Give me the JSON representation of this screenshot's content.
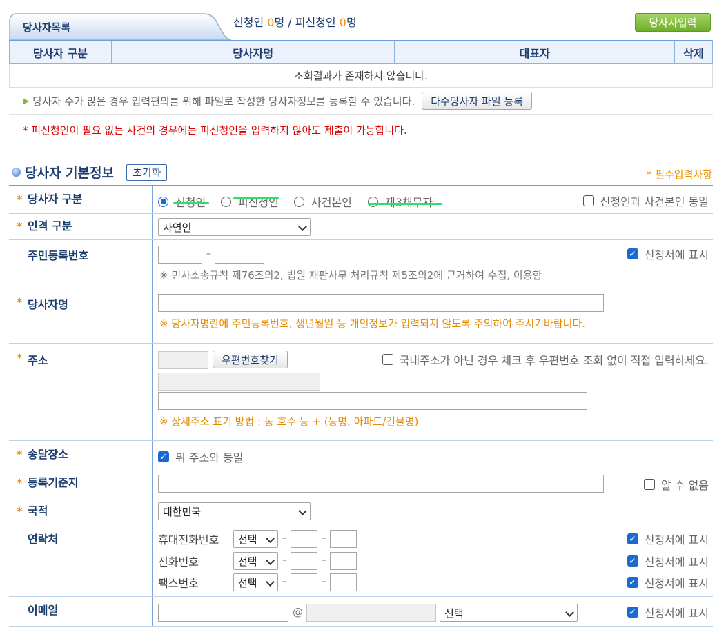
{
  "list": {
    "tab_title": "당사자목록",
    "applicant_label": "신청인",
    "applicant_count": "0",
    "unit1": "명",
    "separator": "/",
    "respondent_label": "피신청인",
    "respondent_count": "0",
    "unit2": "명",
    "add_button": "당사자입력",
    "columns": [
      "당사자 구분",
      "당사자명",
      "대표자",
      "삭제"
    ],
    "empty_message": "조회결과가 존재하지 않습니다.",
    "bulk_info": "당사자 수가 많은 경우 입력편의를 위해 파일로 작성한 당사자정보를 등록할 수 있습니다.",
    "bulk_button": "다수당사자 파일 등록",
    "red_note": "* 피신청인이 필요 없는 사건의 경우에는 피신청인을 입력하지 않아도 제출이 가능합니다."
  },
  "section": {
    "title": "당사자 기본정보",
    "reset_button": "초기화",
    "required_note": "* 필수입력사항"
  },
  "form": {
    "party_type": {
      "label": "당사자 구분",
      "options": [
        "신청인",
        "피신청인",
        "사건본인",
        "제3채무자"
      ],
      "selected": "신청인",
      "same_check": "신청인과 사건본인 동일"
    },
    "person_type": {
      "label": "인격 구분",
      "value": "자연인"
    },
    "rrn": {
      "label": "주민등록번호",
      "show_check": "신청서에 표시",
      "note": "※ 민사소송규칙 제76조의2, 법원 재판사무 처리규칙 제5조의2에 근거하여 수집, 이용함"
    },
    "name": {
      "label": "당사자명",
      "note": "※ 당사자명란에 주민등록번호, 생년월일 등 개인정보가 입력되지 않도록 주의하여 주시기바랍니다."
    },
    "address": {
      "label": "주소",
      "zip_button": "우편번호찾기",
      "foreign_check": "국내주소가 아닌 경우 체크 후 우편번호 조회 없이 직접 입력하세요.",
      "note": "※ 상세주소 표기 방법 : 동 호수 등 + (동명, 아파트/건물명)"
    },
    "delivery": {
      "label": "송달장소",
      "check": "위 주소와 동일"
    },
    "registry": {
      "label": "등록기준지",
      "check": "알 수 없음"
    },
    "nationality": {
      "label": "국적",
      "value": "대한민국"
    },
    "contact": {
      "label": "연락처",
      "rows": [
        {
          "label": "휴대전화번호",
          "select": "선택",
          "check": "신청서에 표시"
        },
        {
          "label": "전화번호",
          "select": "선택",
          "check": "신청서에 표시"
        },
        {
          "label": "팩스번호",
          "select": "선택",
          "check": "신청서에 표시"
        }
      ]
    },
    "email": {
      "label": "이메일",
      "at": "@",
      "select": "선택",
      "check": "신청서에 표시"
    }
  },
  "colors": {
    "accent": "#1a6ad1",
    "required": "#f29100",
    "highlight": "#2ee06a",
    "header_bg": "#ebf2fb"
  }
}
